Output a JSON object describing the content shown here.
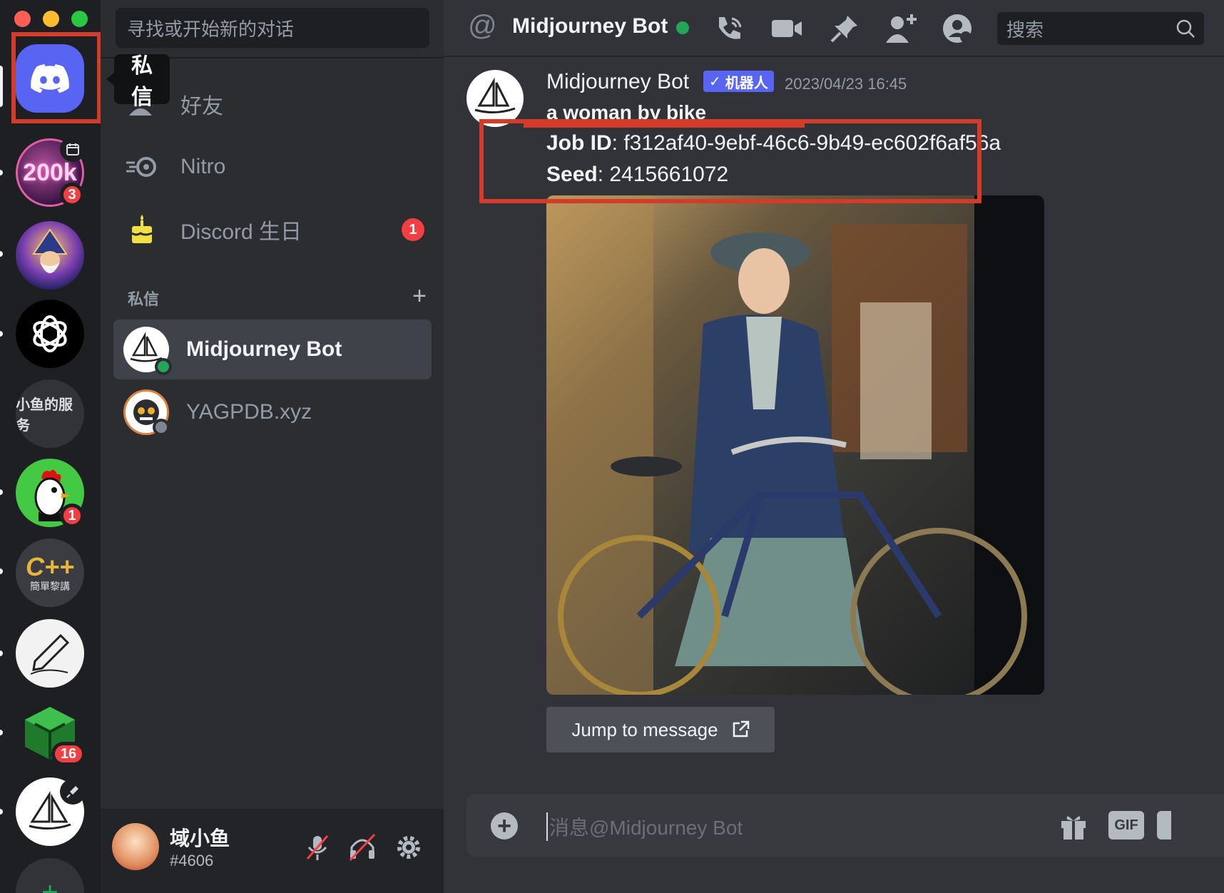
{
  "colors": {
    "blurple": "#5865f2",
    "online": "#23a55a",
    "mention": "#f23f43",
    "highlight": "#d53b29"
  },
  "rail": {
    "home_tooltip": "私信",
    "servers": [
      {
        "name": "200k-server",
        "label": "200k",
        "badge": "3"
      },
      {
        "name": "wizard-server"
      },
      {
        "name": "openai-server"
      },
      {
        "name": "xiaoyu-service-server",
        "label": "小鱼的服务"
      },
      {
        "name": "rooster-server",
        "badge": "1"
      },
      {
        "name": "cpp-server",
        "label_top": "C++",
        "label_bottom": "簡單黎講"
      },
      {
        "name": "pen-server"
      },
      {
        "name": "cube-server",
        "badge": "16"
      },
      {
        "name": "midjourney-server"
      }
    ]
  },
  "dm": {
    "search_placeholder": "寻找或开始新的对话",
    "nav": {
      "friends": "好友",
      "nitro": "Nitro",
      "birthday": "Discord 生日",
      "birthday_badge": "1"
    },
    "section_title": "私信",
    "items": [
      {
        "name": "Midjourney Bot",
        "status": "online"
      },
      {
        "name": "YAGPDB.xyz",
        "status": "offline"
      }
    ]
  },
  "user": {
    "name": "域小鱼",
    "tag": "#4606"
  },
  "header": {
    "channel": "Midjourney Bot",
    "search_placeholder": "搜索"
  },
  "message": {
    "author": "Midjourney Bot",
    "bot_tag": "机器人",
    "timestamp": "2023/04/23 16:45",
    "prompt": "a woman by bike",
    "job_label": "Job ID",
    "job_id": ": f312af40-9ebf-46c6-9b49-ec602f6af56a",
    "seed_label": "Seed",
    "seed": ": 2415661072",
    "jump_button": "Jump to message"
  },
  "composer": {
    "placeholder": "消息@Midjourney Bot",
    "gif": "GIF"
  }
}
